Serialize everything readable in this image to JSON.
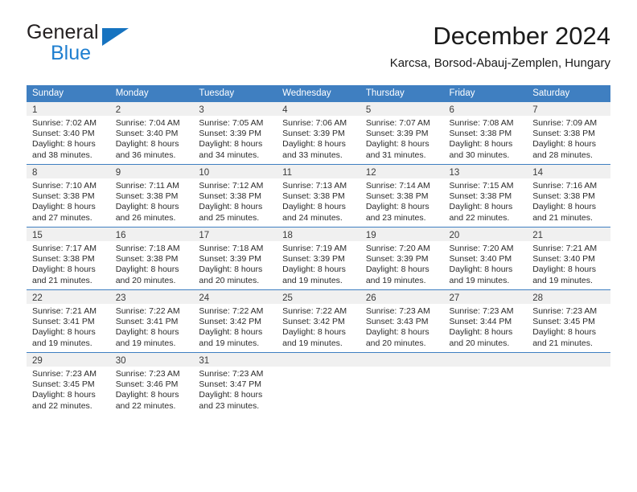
{
  "brand": {
    "name_top": "General",
    "name_bottom": "Blue",
    "triangle_icon": "brand-triangle-icon",
    "color_dark": "#231f20",
    "color_blue": "#1f7fd0"
  },
  "header": {
    "title": "December 2024",
    "subtitle": "Karcsa, Borsod-Abauj-Zemplen, Hungary"
  },
  "theme": {
    "header_bg": "#3f7fc1",
    "header_text": "#ffffff",
    "daynum_bg": "#f0f0f0",
    "cell_bg": "#ffffff",
    "border": "#3f7fc1"
  },
  "calendar": {
    "weekday_headers": [
      "Sunday",
      "Monday",
      "Tuesday",
      "Wednesday",
      "Thursday",
      "Friday",
      "Saturday"
    ],
    "weeks": [
      [
        {
          "day": "1",
          "sunrise": "Sunrise: 7:02 AM",
          "sunset": "Sunset: 3:40 PM",
          "daylight_line1": "Daylight: 8 hours",
          "daylight_line2": "and 38 minutes."
        },
        {
          "day": "2",
          "sunrise": "Sunrise: 7:04 AM",
          "sunset": "Sunset: 3:40 PM",
          "daylight_line1": "Daylight: 8 hours",
          "daylight_line2": "and 36 minutes."
        },
        {
          "day": "3",
          "sunrise": "Sunrise: 7:05 AM",
          "sunset": "Sunset: 3:39 PM",
          "daylight_line1": "Daylight: 8 hours",
          "daylight_line2": "and 34 minutes."
        },
        {
          "day": "4",
          "sunrise": "Sunrise: 7:06 AM",
          "sunset": "Sunset: 3:39 PM",
          "daylight_line1": "Daylight: 8 hours",
          "daylight_line2": "and 33 minutes."
        },
        {
          "day": "5",
          "sunrise": "Sunrise: 7:07 AM",
          "sunset": "Sunset: 3:39 PM",
          "daylight_line1": "Daylight: 8 hours",
          "daylight_line2": "and 31 minutes."
        },
        {
          "day": "6",
          "sunrise": "Sunrise: 7:08 AM",
          "sunset": "Sunset: 3:38 PM",
          "daylight_line1": "Daylight: 8 hours",
          "daylight_line2": "and 30 minutes."
        },
        {
          "day": "7",
          "sunrise": "Sunrise: 7:09 AM",
          "sunset": "Sunset: 3:38 PM",
          "daylight_line1": "Daylight: 8 hours",
          "daylight_line2": "and 28 minutes."
        }
      ],
      [
        {
          "day": "8",
          "sunrise": "Sunrise: 7:10 AM",
          "sunset": "Sunset: 3:38 PM",
          "daylight_line1": "Daylight: 8 hours",
          "daylight_line2": "and 27 minutes."
        },
        {
          "day": "9",
          "sunrise": "Sunrise: 7:11 AM",
          "sunset": "Sunset: 3:38 PM",
          "daylight_line1": "Daylight: 8 hours",
          "daylight_line2": "and 26 minutes."
        },
        {
          "day": "10",
          "sunrise": "Sunrise: 7:12 AM",
          "sunset": "Sunset: 3:38 PM",
          "daylight_line1": "Daylight: 8 hours",
          "daylight_line2": "and 25 minutes."
        },
        {
          "day": "11",
          "sunrise": "Sunrise: 7:13 AM",
          "sunset": "Sunset: 3:38 PM",
          "daylight_line1": "Daylight: 8 hours",
          "daylight_line2": "and 24 minutes."
        },
        {
          "day": "12",
          "sunrise": "Sunrise: 7:14 AM",
          "sunset": "Sunset: 3:38 PM",
          "daylight_line1": "Daylight: 8 hours",
          "daylight_line2": "and 23 minutes."
        },
        {
          "day": "13",
          "sunrise": "Sunrise: 7:15 AM",
          "sunset": "Sunset: 3:38 PM",
          "daylight_line1": "Daylight: 8 hours",
          "daylight_line2": "and 22 minutes."
        },
        {
          "day": "14",
          "sunrise": "Sunrise: 7:16 AM",
          "sunset": "Sunset: 3:38 PM",
          "daylight_line1": "Daylight: 8 hours",
          "daylight_line2": "and 21 minutes."
        }
      ],
      [
        {
          "day": "15",
          "sunrise": "Sunrise: 7:17 AM",
          "sunset": "Sunset: 3:38 PM",
          "daylight_line1": "Daylight: 8 hours",
          "daylight_line2": "and 21 minutes."
        },
        {
          "day": "16",
          "sunrise": "Sunrise: 7:18 AM",
          "sunset": "Sunset: 3:38 PM",
          "daylight_line1": "Daylight: 8 hours",
          "daylight_line2": "and 20 minutes."
        },
        {
          "day": "17",
          "sunrise": "Sunrise: 7:18 AM",
          "sunset": "Sunset: 3:39 PM",
          "daylight_line1": "Daylight: 8 hours",
          "daylight_line2": "and 20 minutes."
        },
        {
          "day": "18",
          "sunrise": "Sunrise: 7:19 AM",
          "sunset": "Sunset: 3:39 PM",
          "daylight_line1": "Daylight: 8 hours",
          "daylight_line2": "and 19 minutes."
        },
        {
          "day": "19",
          "sunrise": "Sunrise: 7:20 AM",
          "sunset": "Sunset: 3:39 PM",
          "daylight_line1": "Daylight: 8 hours",
          "daylight_line2": "and 19 minutes."
        },
        {
          "day": "20",
          "sunrise": "Sunrise: 7:20 AM",
          "sunset": "Sunset: 3:40 PM",
          "daylight_line1": "Daylight: 8 hours",
          "daylight_line2": "and 19 minutes."
        },
        {
          "day": "21",
          "sunrise": "Sunrise: 7:21 AM",
          "sunset": "Sunset: 3:40 PM",
          "daylight_line1": "Daylight: 8 hours",
          "daylight_line2": "and 19 minutes."
        }
      ],
      [
        {
          "day": "22",
          "sunrise": "Sunrise: 7:21 AM",
          "sunset": "Sunset: 3:41 PM",
          "daylight_line1": "Daylight: 8 hours",
          "daylight_line2": "and 19 minutes."
        },
        {
          "day": "23",
          "sunrise": "Sunrise: 7:22 AM",
          "sunset": "Sunset: 3:41 PM",
          "daylight_line1": "Daylight: 8 hours",
          "daylight_line2": "and 19 minutes."
        },
        {
          "day": "24",
          "sunrise": "Sunrise: 7:22 AM",
          "sunset": "Sunset: 3:42 PM",
          "daylight_line1": "Daylight: 8 hours",
          "daylight_line2": "and 19 minutes."
        },
        {
          "day": "25",
          "sunrise": "Sunrise: 7:22 AM",
          "sunset": "Sunset: 3:42 PM",
          "daylight_line1": "Daylight: 8 hours",
          "daylight_line2": "and 19 minutes."
        },
        {
          "day": "26",
          "sunrise": "Sunrise: 7:23 AM",
          "sunset": "Sunset: 3:43 PM",
          "daylight_line1": "Daylight: 8 hours",
          "daylight_line2": "and 20 minutes."
        },
        {
          "day": "27",
          "sunrise": "Sunrise: 7:23 AM",
          "sunset": "Sunset: 3:44 PM",
          "daylight_line1": "Daylight: 8 hours",
          "daylight_line2": "and 20 minutes."
        },
        {
          "day": "28",
          "sunrise": "Sunrise: 7:23 AM",
          "sunset": "Sunset: 3:45 PM",
          "daylight_line1": "Daylight: 8 hours",
          "daylight_line2": "and 21 minutes."
        }
      ],
      [
        {
          "day": "29",
          "sunrise": "Sunrise: 7:23 AM",
          "sunset": "Sunset: 3:45 PM",
          "daylight_line1": "Daylight: 8 hours",
          "daylight_line2": "and 22 minutes."
        },
        {
          "day": "30",
          "sunrise": "Sunrise: 7:23 AM",
          "sunset": "Sunset: 3:46 PM",
          "daylight_line1": "Daylight: 8 hours",
          "daylight_line2": "and 22 minutes."
        },
        {
          "day": "31",
          "sunrise": "Sunrise: 7:23 AM",
          "sunset": "Sunset: 3:47 PM",
          "daylight_line1": "Daylight: 8 hours",
          "daylight_line2": "and 23 minutes."
        },
        {
          "day": "",
          "sunrise": "",
          "sunset": "",
          "daylight_line1": "",
          "daylight_line2": ""
        },
        {
          "day": "",
          "sunrise": "",
          "sunset": "",
          "daylight_line1": "",
          "daylight_line2": ""
        },
        {
          "day": "",
          "sunrise": "",
          "sunset": "",
          "daylight_line1": "",
          "daylight_line2": ""
        },
        {
          "day": "",
          "sunrise": "",
          "sunset": "",
          "daylight_line1": "",
          "daylight_line2": ""
        }
      ]
    ]
  }
}
